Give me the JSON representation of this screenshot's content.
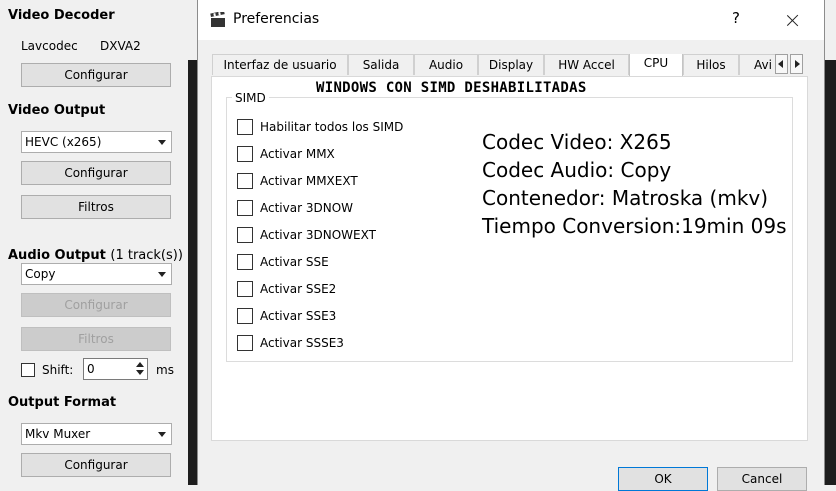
{
  "left_panel": {
    "video_decoder": {
      "title": "Video Decoder",
      "decoder": "Lavcodec",
      "hw": "DXVA2",
      "configure_label": "Configurar"
    },
    "video_output": {
      "title": "Video Output",
      "codec": "HEVC (x265)",
      "configure_label": "Configurar",
      "filters_label": "Filtros"
    },
    "audio_output": {
      "title": "Audio Output",
      "tracks": "(1 track(s))",
      "codec": "Copy",
      "configure_label": "Configurar",
      "filters_label": "Filtros",
      "shift_label": "Shift:",
      "shift_value": "0",
      "shift_unit": "ms"
    },
    "output_format": {
      "title": "Output Format",
      "muxer": "Mkv Muxer",
      "configure_label": "Configurar"
    }
  },
  "dialog": {
    "title": "Preferencias",
    "help_label": "?",
    "tabs": [
      "Interfaz de usuario",
      "Salida",
      "Audio",
      "Display",
      "HW Accel",
      "CPU",
      "Hilos",
      "Avi"
    ],
    "active_tab": "CPU",
    "overlay_title": "WINDOWS CON SIMD DESHABILITADAS",
    "simd_group": "SIMD",
    "simd_options": [
      "Habilitar todos los SIMD",
      "Activar MMX",
      "Activar MMXEXT",
      "Activar 3DNOW",
      "Activar 3DNOWEXT",
      "Activar SSE",
      "Activar SSE2",
      "Activar SSE3",
      "Activar SSSE3"
    ],
    "info_lines": [
      "Codec Video: X265",
      "Codec Audio: Copy",
      "Contenedor: Matroska (mkv)",
      "Tiempo Conversion:19min 09s"
    ],
    "ok_label": "OK",
    "cancel_label": "Cancel"
  }
}
